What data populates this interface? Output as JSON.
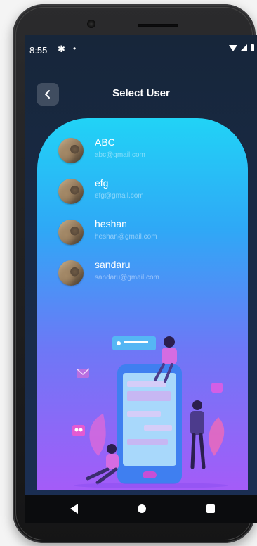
{
  "status_bar": {
    "time": "8:55",
    "settings_icon": "gear-icon",
    "dot": "•"
  },
  "app_bar": {
    "title": "Select User",
    "back_icon": "chevron-left-icon"
  },
  "users": [
    {
      "name": "ABC",
      "email": "abc@gmail.com"
    },
    {
      "name": "efg",
      "email": "efg@gmail.com"
    },
    {
      "name": "heshan",
      "email": "heshan@gmail.com"
    },
    {
      "name": "sandaru",
      "email": "sandaru@gmail.com"
    }
  ],
  "colors": {
    "card_top": "#21d3f6",
    "card_bottom": "#a45cf8",
    "screen_bg": "#182a47"
  },
  "nav_bar": {
    "back_icon": "triangle-back-icon",
    "home_icon": "circle-home-icon",
    "recents_icon": "square-recents-icon"
  }
}
